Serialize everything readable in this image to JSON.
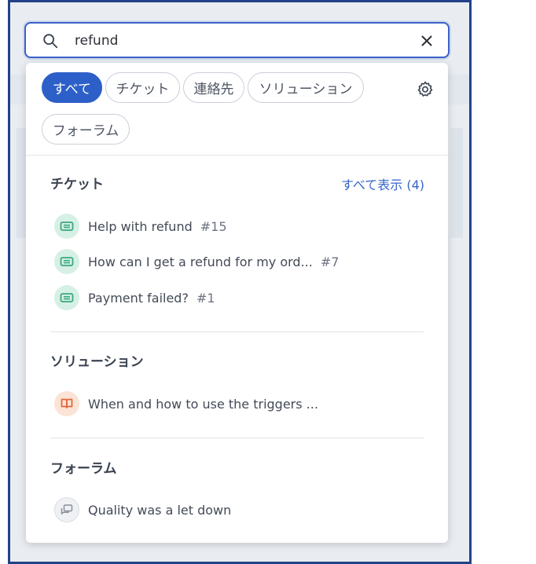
{
  "search": {
    "value": "refund"
  },
  "filters": [
    {
      "label": "すべて",
      "active": true
    },
    {
      "label": "チケット",
      "active": false
    },
    {
      "label": "連絡先",
      "active": false
    },
    {
      "label": "ソリューション",
      "active": false
    },
    {
      "label": "フォーラム",
      "active": false
    }
  ],
  "sections": {
    "tickets": {
      "title": "チケット",
      "show_all": "すべて表示 (4)",
      "items": [
        {
          "text": "Help with refund",
          "num": "#15"
        },
        {
          "text": "How can I get a refund for my ord...",
          "num": "#7"
        },
        {
          "text": "Payment failed?",
          "num": "#1"
        }
      ]
    },
    "solutions": {
      "title": "ソリューション",
      "items": [
        {
          "text": "When and how to use the triggers ..."
        }
      ]
    },
    "forums": {
      "title": "フォーラム",
      "items": [
        {
          "text": "Quality was a let down"
        }
      ]
    }
  },
  "colors": {
    "accent": "#2d5fc9",
    "link": "#3566c8",
    "ticket_icon": "#3aa87c",
    "solution_icon": "#e0663a",
    "forum_icon": "#8a909a",
    "frame": "#23418a"
  },
  "icons": [
    "search-icon",
    "close-icon",
    "gear-icon",
    "ticket-icon",
    "book-icon",
    "chat-icon"
  ]
}
